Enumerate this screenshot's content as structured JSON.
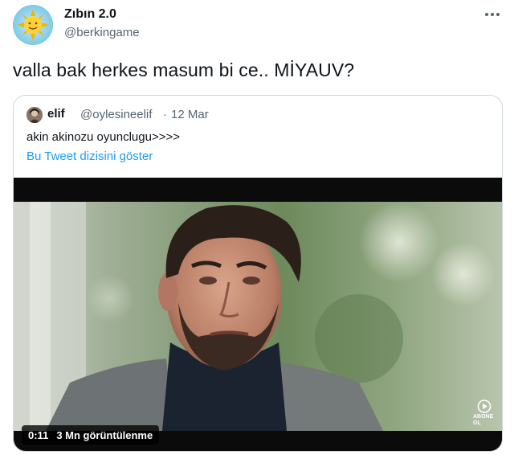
{
  "author": {
    "name": "Zıbın 2.0",
    "handle": "@berkingame"
  },
  "tweet": {
    "text": "valla bak herkes masum bi ce.. MİYAUV?"
  },
  "quoted": {
    "name": "elif",
    "handle": "@oylesineelif",
    "separator": "·",
    "date": "12 Mar",
    "text": "akin akinozu oyunclugu>>>>",
    "thread_link": "Bu Tweet dizisini göster"
  },
  "video": {
    "time": "0:11",
    "views": "3 Mn görüntülenme",
    "watermark": "ABONE OL"
  },
  "icons": {
    "more": "more-horizontal-icon",
    "watermark": "play-circle-icon"
  },
  "colors": {
    "link": "#1d9bf0",
    "secondary_text": "#536471",
    "border": "#cfd9de"
  }
}
